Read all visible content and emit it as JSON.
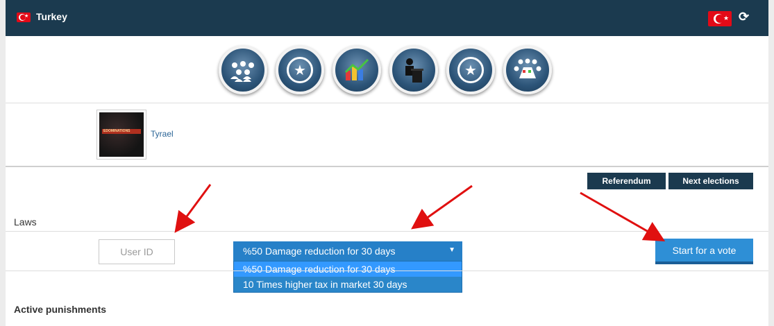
{
  "header": {
    "title": "Turkey",
    "icon_left": "turkey-flag-icon",
    "icon_right": "turkey-flag-icon",
    "refresh_icon": "refresh-icon"
  },
  "icons": [
    {
      "name": "people-icon"
    },
    {
      "name": "star-icon"
    },
    {
      "name": "chart-icon"
    },
    {
      "name": "speaker-podium-icon"
    },
    {
      "name": "star-icon"
    },
    {
      "name": "meeting-table-icon"
    }
  ],
  "profile": {
    "username": "Tyrael",
    "avatar_text": "EDOMINATIONS"
  },
  "buttons": {
    "referendum": "Referendum",
    "next_elections": "Next elections",
    "start_vote": "Start for a vote"
  },
  "laws": {
    "label": "Laws",
    "user_id_placeholder": "User ID",
    "selected": "%50 Damage reduction for 30 days",
    "options": [
      "%50 Damage reduction for 30 days",
      "10 Times higher tax in market 30 days"
    ]
  },
  "active_punishments": {
    "label": "Active punishments"
  },
  "colors": {
    "header_bg": "#1b3a4f",
    "accent_blue": "#2e8fd6",
    "arrow_red": "#e01010"
  }
}
